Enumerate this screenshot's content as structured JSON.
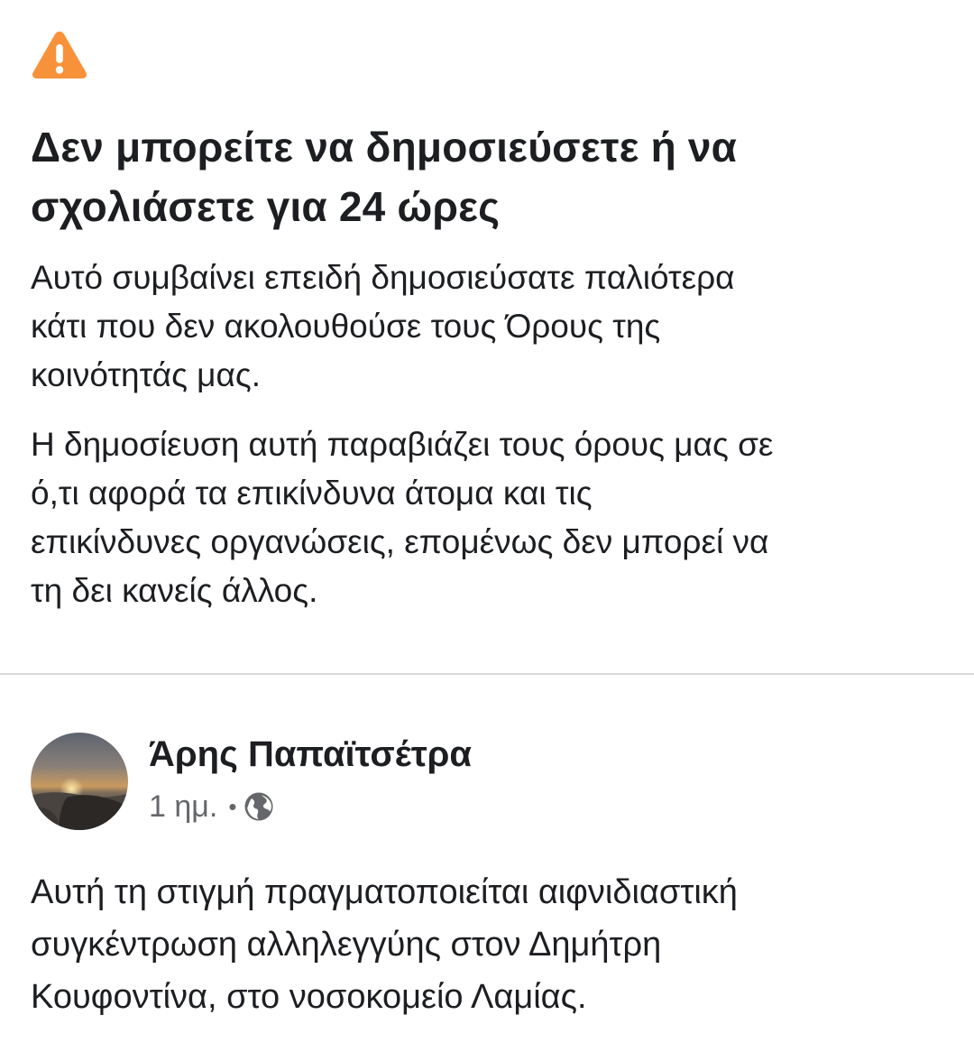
{
  "warning": {
    "icon": "warning-triangle-icon",
    "color": "#f7923b"
  },
  "notice": {
    "title_line1": "Δεν μπορείτε να δημοσιεύσετε ή να",
    "title_line2": "σχολιάσετε για 24 ώρες",
    "paragraph1_line1": "Αυτό συμβαίνει επειδή δημοσιεύσατε παλιότερα",
    "paragraph1_line2": "κάτι που δεν ακολουθούσε τους Όρους της",
    "paragraph1_line3": "κοινότητάς μας.",
    "paragraph2_line1": "Η δημοσίευση αυτή παραβιάζει τους όρους μας σε",
    "paragraph2_line2": "ό,τι αφορά τα επικίνδυνα άτομα και τις",
    "paragraph2_line3": "επικίνδυνες οργανώσεις, επομένως δεν μπορεί να",
    "paragraph2_line4": "τη δει κανείς άλλος."
  },
  "post": {
    "author": "Άρης Παπαϊτσέτρα",
    "time": "1 ημ.",
    "separator": "•",
    "privacy_icon": "globe-icon",
    "body_line1": "Αυτή τη στιγμή πραγματοποιείται αιφνιδιαστική",
    "body_line2": "συγκέντρωση αλληλεγγύης στον Δημήτρη",
    "body_line3": "Κουφοντίνα, στο νοσοκομείο Λαμίας."
  }
}
